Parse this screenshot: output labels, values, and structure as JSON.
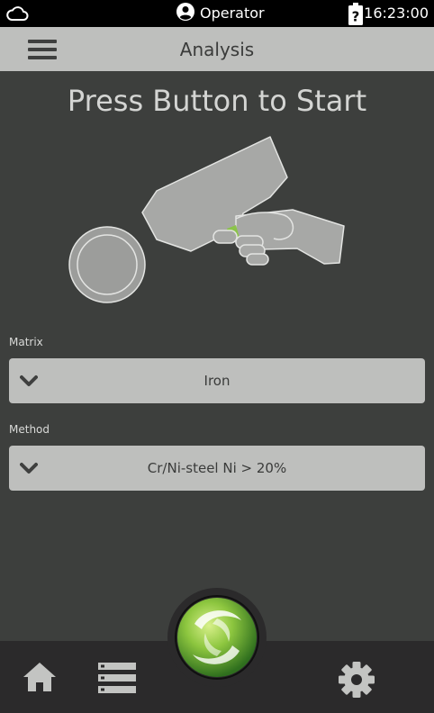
{
  "status_bar": {
    "cloud_icon": "cloud-icon",
    "user_icon": "user-circle-icon",
    "user_label": "Operator",
    "battery_icon": "battery-unknown-icon",
    "time": "16:23:00"
  },
  "header": {
    "menu_icon": "hamburger-menu-icon",
    "title": "Analysis"
  },
  "main": {
    "prompt": "Press Button to Start",
    "illustration": "handheld-analyzer-with-sample-icon",
    "matrix": {
      "label": "Matrix",
      "value": "Iron"
    },
    "method": {
      "label": "Method",
      "value": "Cr/Ni-steel Ni > 20%"
    }
  },
  "bottom_nav": {
    "home_icon": "home-icon",
    "list_icon": "list-icon",
    "settings_icon": "gear-icon",
    "start_icon": "start-analysis-button-icon"
  },
  "colors": {
    "background": "#3d3f3d",
    "status_bar": "#000000",
    "header": "#bebfbd",
    "select": "#bebfbd",
    "bottom_nav": "#2b2a2b",
    "accent_green": "#8bc34a"
  }
}
